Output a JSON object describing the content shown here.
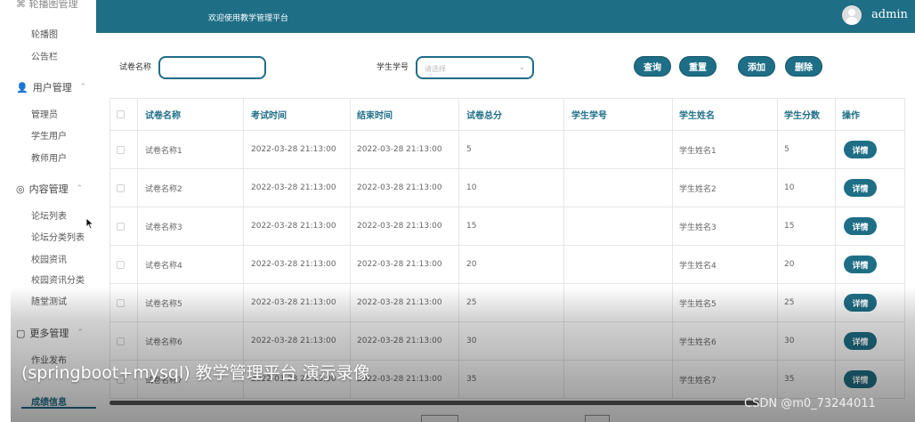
{
  "header": {
    "title": "欢迎使用教学管理平台",
    "username": "admin"
  },
  "sidebar": {
    "top_cut": "轮播图管理",
    "items": [
      {
        "label": "轮播图"
      },
      {
        "label": "公告栏"
      }
    ],
    "groups": [
      {
        "label": "用户管理",
        "icon": "user-icon",
        "items": [
          "管理员",
          "学生用户",
          "教师用户"
        ]
      },
      {
        "label": "内容管理",
        "icon": "chat-icon",
        "items": [
          "论坛列表",
          "论坛分类列表",
          "校园资讯",
          "校园资讯分类",
          "随堂测试"
        ]
      },
      {
        "label": "更多管理",
        "icon": "window-icon",
        "items": [
          "作业发布",
          "成绩信息"
        ]
      }
    ]
  },
  "search": {
    "paper_label": "试卷名称",
    "paper_value": "",
    "student_label": "学生学号",
    "student_placeholder": "请选择",
    "buttons": {
      "query": "查询",
      "reset": "重置",
      "add": "添加",
      "delete": "删除"
    }
  },
  "table": {
    "headers": [
      "试卷名称",
      "考试时间",
      "结束时间",
      "试卷总分",
      "学生学号",
      "学生姓名",
      "学生分数",
      "操作"
    ],
    "detail_label": "详情",
    "rows": [
      {
        "name": "试卷名称1",
        "start": "2022-03-28 21:13:00",
        "end": "2022-03-28 21:13:00",
        "total": "5",
        "sid": "",
        "sname": "学生姓名1",
        "score": "5"
      },
      {
        "name": "试卷名称2",
        "start": "2022-03-28 21:13:00",
        "end": "2022-03-28 21:13:00",
        "total": "10",
        "sid": "",
        "sname": "学生姓名2",
        "score": "10"
      },
      {
        "name": "试卷名称3",
        "start": "2022-03-28 21:13:00",
        "end": "2022-03-28 21:13:00",
        "total": "15",
        "sid": "",
        "sname": "学生姓名3",
        "score": "15"
      },
      {
        "name": "试卷名称4",
        "start": "2022-03-28 21:13:00",
        "end": "2022-03-28 21:13:00",
        "total": "20",
        "sid": "",
        "sname": "学生姓名4",
        "score": "20"
      },
      {
        "name": "试卷名称5",
        "start": "2022-03-28 21:13:00",
        "end": "2022-03-28 21:13:00",
        "total": "25",
        "sid": "",
        "sname": "学生姓名5",
        "score": "25"
      },
      {
        "name": "试卷名称6",
        "start": "2022-03-28 21:13:00",
        "end": "2022-03-28 21:13:00",
        "total": "30",
        "sid": "",
        "sname": "学生姓名6",
        "score": "30"
      },
      {
        "name": "试卷名称7",
        "start": "2022-03-28 21:13:00",
        "end": "2022-03-28 21:13:00",
        "total": "35",
        "sid": "",
        "sname": "学生姓名7",
        "score": "35"
      }
    ]
  },
  "overlay": {
    "video_title": "(springboot+mysql) 教学管理平台 演示录像",
    "watermark": "CSDN @m0_73244011"
  },
  "colors": {
    "accent": "#1e6e86"
  }
}
